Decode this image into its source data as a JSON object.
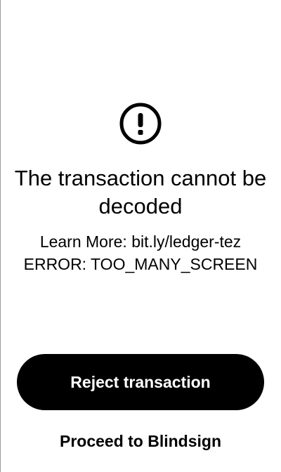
{
  "status": {
    "icon": "exclamation-circle-icon",
    "title": "The transaction cannot be decoded"
  },
  "details": {
    "learn_more": "Learn More: bit.ly/ledger-tez",
    "error": "ERROR: TOO_MANY_SCREEN"
  },
  "actions": {
    "reject_label": "Reject transaction",
    "proceed_label": "Proceed to Blindsign"
  },
  "colors": {
    "background": "#ffffff",
    "foreground": "#000000",
    "button_bg": "#000000",
    "button_text": "#ffffff"
  }
}
